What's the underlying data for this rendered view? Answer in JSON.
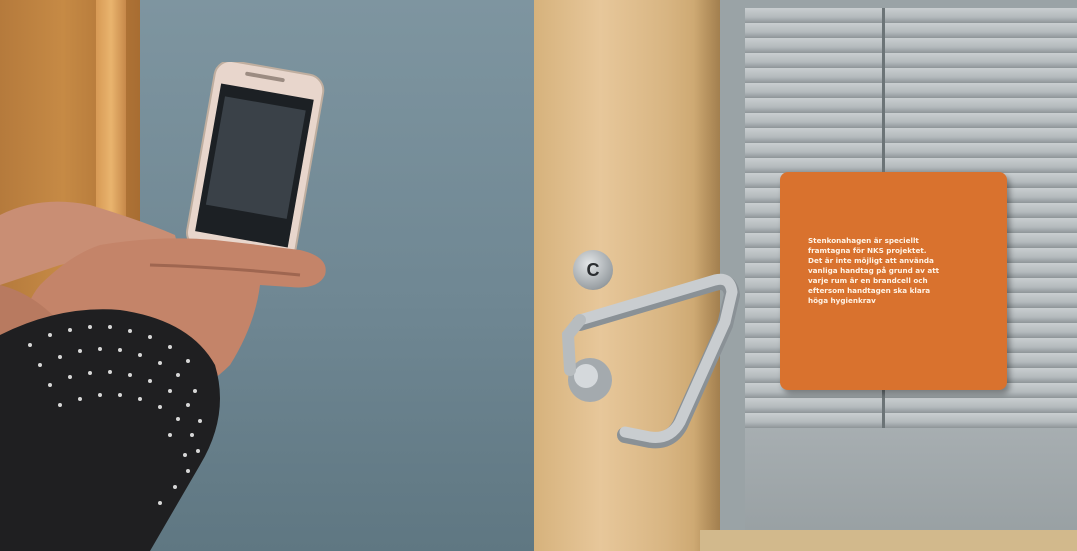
{
  "sign": {
    "text": "Stenkonahagen är speciellt\nframtagna för NKS projektet.\nDet är inte möjligt att använda\nvanliga handtag på grund av att\nvarje rum är en brandcell och\neftersom handtagen ska klara\nhöga hygienkrav"
  },
  "lock": {
    "letter": "C"
  },
  "colors": {
    "wall": "#6f8793",
    "door_wood": "#e7c79a",
    "sign_orange": "#d9722e",
    "blinds": "#b4babd",
    "sleeve": "#1f1f21"
  }
}
